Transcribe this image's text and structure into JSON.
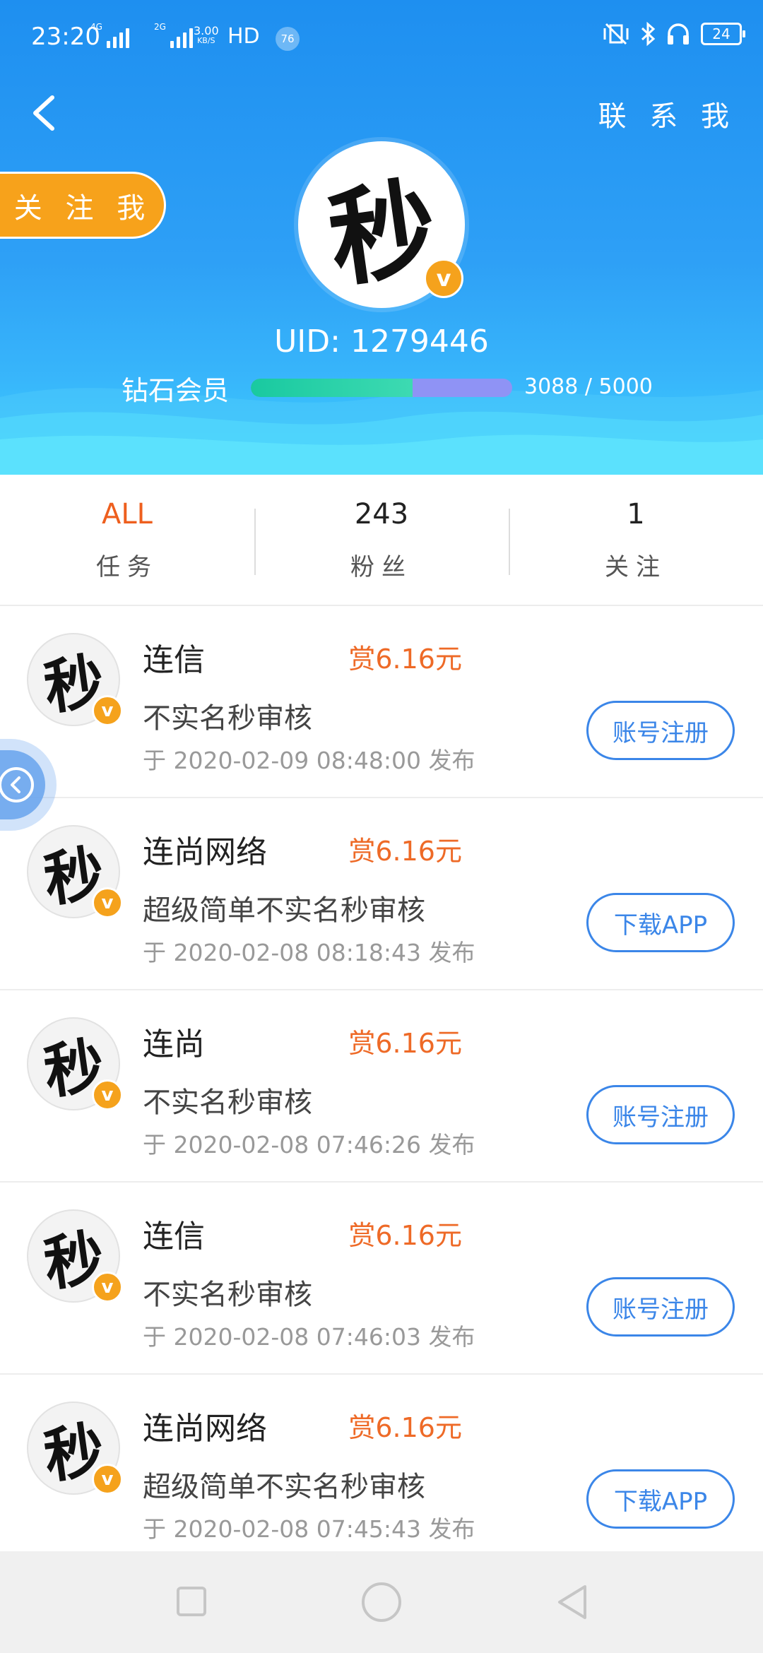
{
  "status_bar": {
    "time": "23:20",
    "network1": "4G",
    "network2": "2G",
    "speed_value": "3.00",
    "speed_unit": "KB/S",
    "hd": "HD",
    "notification_count": "76",
    "battery": "24"
  },
  "header": {
    "contact_label": "联 系 我",
    "follow_label": "关 注 我",
    "avatar_char": "秒",
    "verified_char": "v",
    "uid": "UID: 1279446",
    "level_name": "钻石会员",
    "level_progress": 0.6176,
    "level_text": "3088 / 5000",
    "colors": {
      "accent": "#1e8ff0",
      "follow": "#f7a21b"
    }
  },
  "stats": [
    {
      "value": "ALL",
      "label": "任务"
    },
    {
      "value": "243",
      "label": "粉丝"
    },
    {
      "value": "1",
      "label": "关注"
    }
  ],
  "tasks": [
    {
      "avatar_char": "秒",
      "verified_char": "v",
      "title": "连信",
      "reward": "赏6.16元",
      "desc": "不实名秒审核",
      "date": "于 2020-02-09 08:48:00 发布",
      "action": "账号注册"
    },
    {
      "avatar_char": "秒",
      "verified_char": "v",
      "title": "连尚网络",
      "reward": "赏6.16元",
      "desc": "超级简单不实名秒审核",
      "date": "于 2020-02-08 08:18:43 发布",
      "action": "下载APP"
    },
    {
      "avatar_char": "秒",
      "verified_char": "v",
      "title": "连尚",
      "reward": "赏6.16元",
      "desc": "不实名秒审核",
      "date": "于 2020-02-08 07:46:26 发布",
      "action": "账号注册"
    },
    {
      "avatar_char": "秒",
      "verified_char": "v",
      "title": "连信",
      "reward": "赏6.16元",
      "desc": "不实名秒审核",
      "date": "于 2020-02-08 07:46:03 发布",
      "action": "账号注册"
    },
    {
      "avatar_char": "秒",
      "verified_char": "v",
      "title": "连尚网络",
      "reward": "赏6.16元",
      "desc": "超级简单不实名秒审核",
      "date": "于 2020-02-08 07:45:43 发布",
      "action": "下载APP"
    }
  ]
}
